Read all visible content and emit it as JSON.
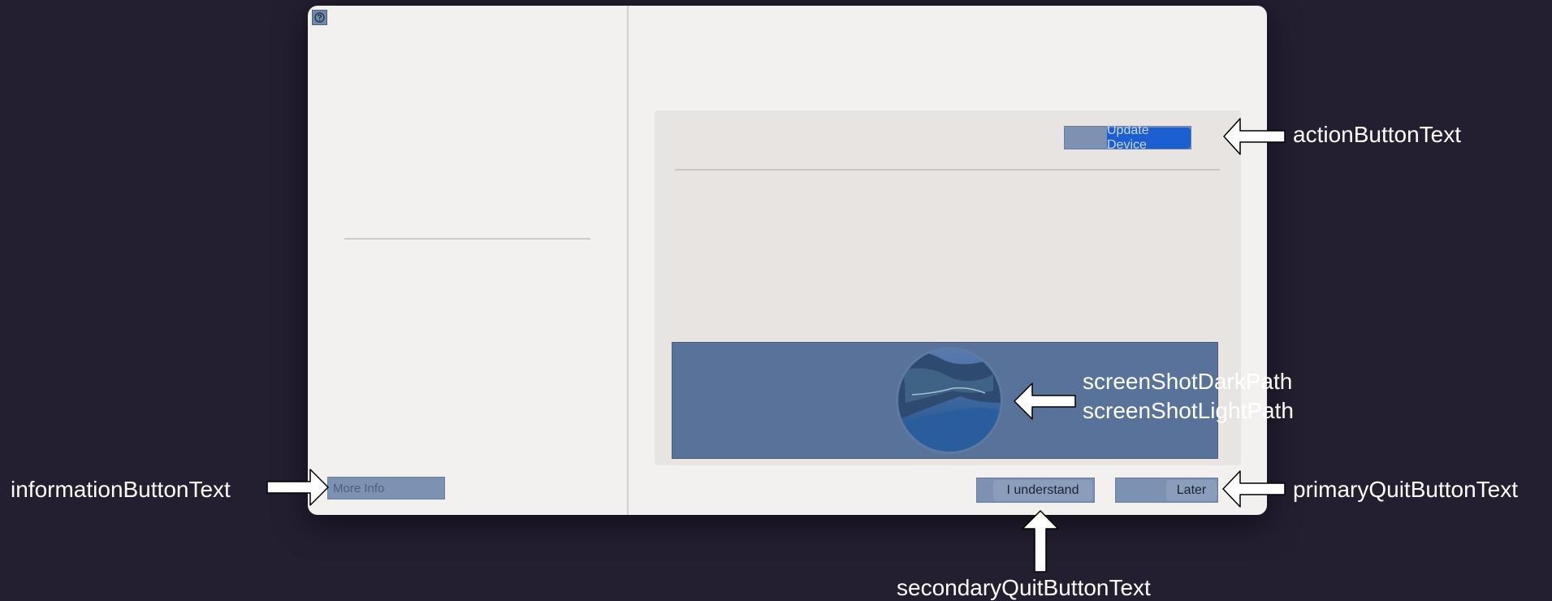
{
  "window": {
    "action_button_text": "Update Device",
    "information_button_text": "More Info",
    "secondary_quit_button_text": "I understand",
    "primary_quit_button_text": "Later"
  },
  "annotations": {
    "action_button": "actionButtonText",
    "screenshot_dark": "screenShotDarkPath",
    "screenshot_light": "screenShotLightPath",
    "information_button": "informationButtonText",
    "primary_quit": "primaryQuitButtonText",
    "secondary_quit": "secondaryQuitButtonText"
  },
  "colors": {
    "background": "#241e31",
    "window": "#f3f1ef",
    "accent_blue": "#1b5fd0",
    "overlay": "#7d91b2"
  },
  "icons": [
    "help-icon",
    "screenshot-image"
  ]
}
